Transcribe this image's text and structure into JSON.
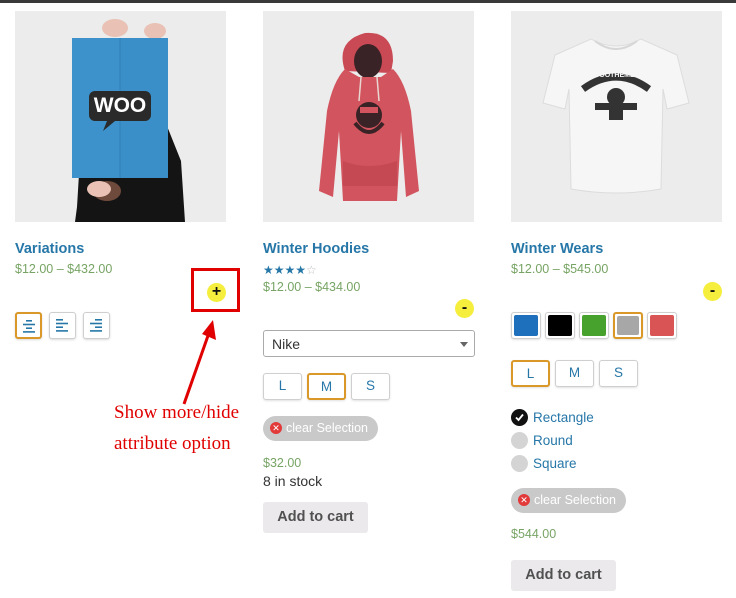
{
  "products": [
    {
      "title": "Variations",
      "price": "$12.00 – $432.00",
      "toggle": "+",
      "alignment_options": [
        "align-center-icon",
        "align-left-icon",
        "align-right-icon"
      ]
    },
    {
      "title": "Winter Hoodies",
      "rating": 4,
      "rating_max": 5,
      "price": "$12.00 – $434.00",
      "toggle": "-",
      "brand_select": "Nike",
      "sizes": [
        "L",
        "M",
        "S"
      ],
      "selected_size": "M",
      "clear_label": "clear Selection",
      "variation_price": "$32.00",
      "stock": "8 in stock",
      "add_to_cart": "Add to cart"
    },
    {
      "title": "Winter Wears",
      "price": "$12.00 – $545.00",
      "toggle": "-",
      "colors": [
        "#1e6fbc",
        "#000000",
        "#47a22d",
        "#a7a7a7",
        "#d95454"
      ],
      "selected_color": "#a7a7a7",
      "sizes": [
        "L",
        "M",
        "S"
      ],
      "selected_size": "L",
      "shapes": [
        "Rectangle",
        "Round",
        "Square"
      ],
      "selected_shape": "Rectangle",
      "clear_label": "clear Selection",
      "variation_price": "$544.00",
      "add_to_cart": "Add to cart"
    }
  ],
  "poster_logo": "WOO",
  "tshirt_logo": "WOOTHEMES",
  "annotation": {
    "line1": "Show more/hide",
    "line2": "attribute option"
  }
}
